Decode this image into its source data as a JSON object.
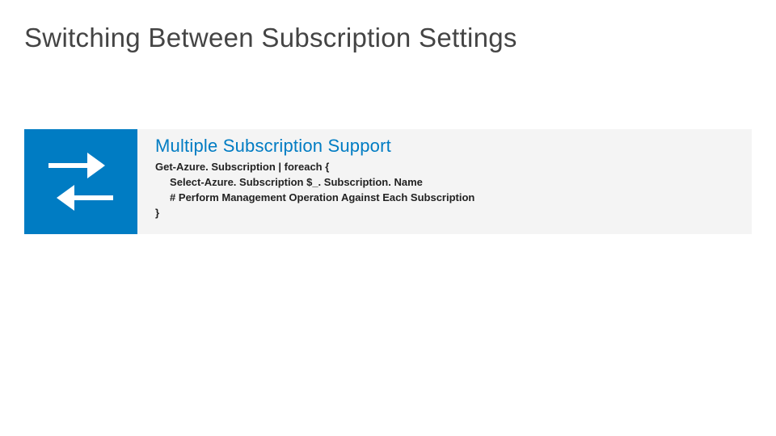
{
  "title": "Switching Between Subscription Settings",
  "panel": {
    "heading": "Multiple Subscription Support",
    "code": {
      "line1": "Get-Azure. Subscription | foreach {",
      "line2": "     Select-Azure. Subscription $_. Subscription. Name",
      "line3": "     # Perform Management Operation Against Each Subscription",
      "line4": "}"
    }
  }
}
